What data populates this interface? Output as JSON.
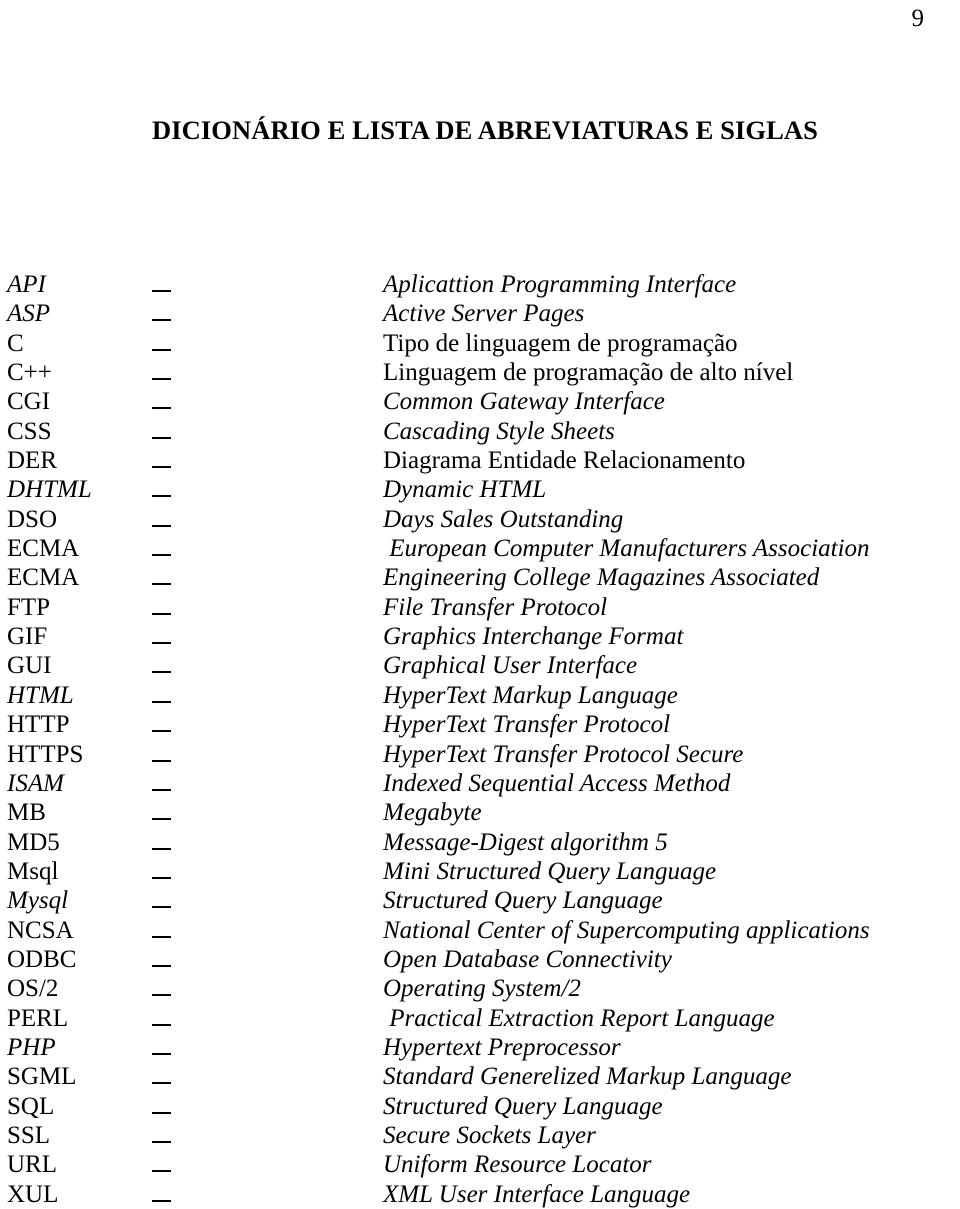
{
  "page": {
    "number": "9",
    "title": "DICIONÁRIO E LISTA DE ABREVIATURAS E SIGLAS",
    "separator": "–"
  },
  "glossary": {
    "entries": [
      {
        "abbr": "API",
        "abbr_style": "italic",
        "abbr_prefix": "",
        "definition": "Aplicattion Programming Interface",
        "definition_style": "italic"
      },
      {
        "abbr": "ASP",
        "abbr_style": "italic",
        "abbr_prefix": "",
        "definition": "Active Server Pages",
        "definition_style": "italic"
      },
      {
        "abbr": "C",
        "abbr_style": "roman",
        "abbr_prefix": "",
        "definition": "Tipo de linguagem de programação",
        "definition_style": "roman"
      },
      {
        "abbr": "C++",
        "abbr_style": "roman",
        "abbr_prefix": "",
        "definition": "Linguagem de programação de alto nível",
        "definition_style": "roman"
      },
      {
        "abbr": "CGI",
        "abbr_style": "roman",
        "abbr_prefix": "",
        "definition": "Common Gateway Interface",
        "definition_style": "italic"
      },
      {
        "abbr": "CSS",
        "abbr_style": "roman",
        "abbr_prefix": "",
        "definition": "Cascading Style Sheets",
        "definition_style": "italic"
      },
      {
        "abbr": "DER",
        "abbr_style": "roman",
        "abbr_prefix": "",
        "definition": "Diagrama Entidade Relacionamento",
        "definition_style": "roman"
      },
      {
        "abbr": "HTML",
        "abbr_style": "italic",
        "abbr_prefix": "D",
        "definition": "Dynamic HTML",
        "definition_style": "italic"
      },
      {
        "abbr": "DSO",
        "abbr_style": "roman",
        "abbr_prefix": "",
        "definition": "Days Sales Outstanding",
        "definition_style": "italic"
      },
      {
        "abbr": "ECMA",
        "abbr_style": "roman",
        "abbr_prefix": "",
        "definition": " European Computer Manufacturers Association",
        "definition_style": "italic"
      },
      {
        "abbr": "ECMA",
        "abbr_style": "roman",
        "abbr_prefix": "",
        "definition": "Engineering College Magazines Associated",
        "definition_style": "italic"
      },
      {
        "abbr": "FTP",
        "abbr_style": "roman",
        "abbr_prefix": "",
        "definition": "File Transfer Protocol",
        "definition_style": "italic"
      },
      {
        "abbr": "GIF",
        "abbr_style": "roman",
        "abbr_prefix": "",
        "definition": "Graphics Interchange Format",
        "definition_style": "italic"
      },
      {
        "abbr": "GUI",
        "abbr_style": "roman",
        "abbr_prefix": "",
        "definition": "Graphical User Interface",
        "definition_style": "italic"
      },
      {
        "abbr": "HTML",
        "abbr_style": "italic",
        "abbr_prefix": "",
        "definition": "HyperText Markup Language",
        "definition_style": "italic"
      },
      {
        "abbr": "HTTP",
        "abbr_style": "roman",
        "abbr_prefix": "",
        "definition": "HyperText Transfer Protocol",
        "definition_style": "italic"
      },
      {
        "abbr": "HTTPS",
        "abbr_style": "roman",
        "abbr_prefix": "",
        "definition": "HyperText Transfer Protocol Secure",
        "definition_style": "italic"
      },
      {
        "abbr": "ISAM",
        "abbr_style": "italic",
        "abbr_prefix": "",
        "definition": "Indexed Sequential Access Method",
        "definition_style": "italic"
      },
      {
        "abbr": "MB",
        "abbr_style": "roman",
        "abbr_prefix": "",
        "definition": "Megabyte",
        "definition_style": "italic"
      },
      {
        "abbr": "MD5",
        "abbr_style": "roman",
        "abbr_prefix": "",
        "definition": "Message-Digest algorithm 5",
        "definition_style": "italic"
      },
      {
        "abbr": "Msql",
        "abbr_style": "roman",
        "abbr_prefix": "",
        "definition": "Mini Structured Query Language",
        "definition_style": "italic"
      },
      {
        "abbr": "Mysql",
        "abbr_style": "italic",
        "abbr_prefix": "",
        "definition": "Structured Query Language",
        "definition_style": "italic"
      },
      {
        "abbr": "NCSA",
        "abbr_style": "roman",
        "abbr_prefix": "",
        "definition": "National Center of Supercomputing applications",
        "definition_style": "italic"
      },
      {
        "abbr": "ODBC",
        "abbr_style": "roman",
        "abbr_prefix": "",
        "definition": "Open Database Connectivity",
        "definition_style": "italic"
      },
      {
        "abbr": "OS/2",
        "abbr_style": "roman",
        "abbr_prefix": "",
        "definition": "Operating System/2",
        "definition_style": "italic"
      },
      {
        "abbr": "PERL",
        "abbr_style": "roman",
        "abbr_prefix": "",
        "definition": " Practical Extraction Report Language",
        "definition_style": "italic"
      },
      {
        "abbr": "PHP",
        "abbr_style": "italic",
        "abbr_prefix": "",
        "definition": "Hypertext Preprocessor",
        "definition_style": "italic"
      },
      {
        "abbr": "SGML",
        "abbr_style": "roman",
        "abbr_prefix": "",
        "definition": "Standard Generelized Markup Language",
        "definition_style": "italic"
      },
      {
        "abbr": "SQL",
        "abbr_style": "roman",
        "abbr_prefix": "",
        "definition": "Structured Query Language",
        "definition_style": "italic"
      },
      {
        "abbr": "SSL",
        "abbr_style": "roman",
        "abbr_prefix": "",
        "definition": "Secure Sockets Layer",
        "definition_style": "italic"
      },
      {
        "abbr": "URL",
        "abbr_style": "roman",
        "abbr_prefix": "",
        "definition": "Uniform Resource Locator",
        "definition_style": "italic"
      },
      {
        "abbr": "XUL",
        "abbr_style": "roman",
        "abbr_prefix": "",
        "definition": "XML User Interface Language",
        "definition_style": "italic"
      }
    ]
  }
}
